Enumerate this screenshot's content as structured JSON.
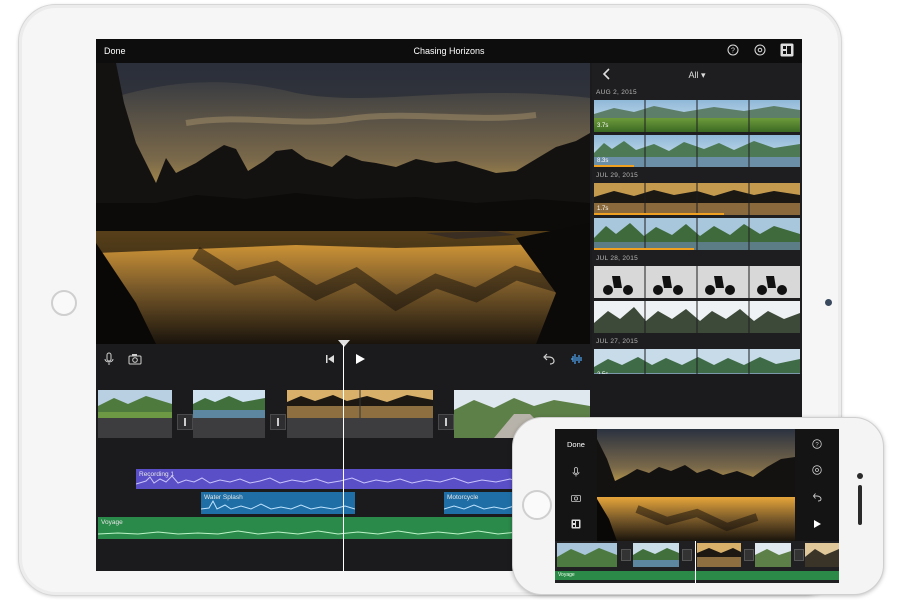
{
  "ipad": {
    "top_bar": {
      "done_label": "Done",
      "title": "Chasing Horizons"
    },
    "top_bar_icons": [
      "help-icon",
      "settings-icon",
      "media-browser-icon"
    ],
    "browser": {
      "filter_label": "All ▾",
      "groups": [
        {
          "date": "AUG 2, 2015",
          "clips": [
            {
              "duration": "3.7s"
            },
            {
              "duration": "8.3s"
            }
          ]
        },
        {
          "date": "JUL 29, 2015",
          "clips": [
            {
              "duration": "1.7s"
            },
            {
              "duration": ""
            }
          ]
        },
        {
          "date": "JUL 28, 2015",
          "clips": [
            {
              "duration": ""
            },
            {
              "duration": ""
            }
          ]
        },
        {
          "date": "JUL 27, 2015",
          "clips": [
            {
              "duration": "2.5s"
            },
            {
              "duration": ""
            }
          ]
        }
      ]
    },
    "timeline": {
      "tracks": {
        "recording": "Recording 1",
        "water": "Water Splash",
        "moto": "Motorcycle",
        "music": "Voyage"
      }
    },
    "colors": {
      "recording_track": "#5a4fc6",
      "audio_track": "#1f6fa6",
      "music_track": "#2a8a4a",
      "selection": "#f0a020"
    }
  },
  "iphone": {
    "done_label": "Done",
    "music_label": "Voyage"
  }
}
